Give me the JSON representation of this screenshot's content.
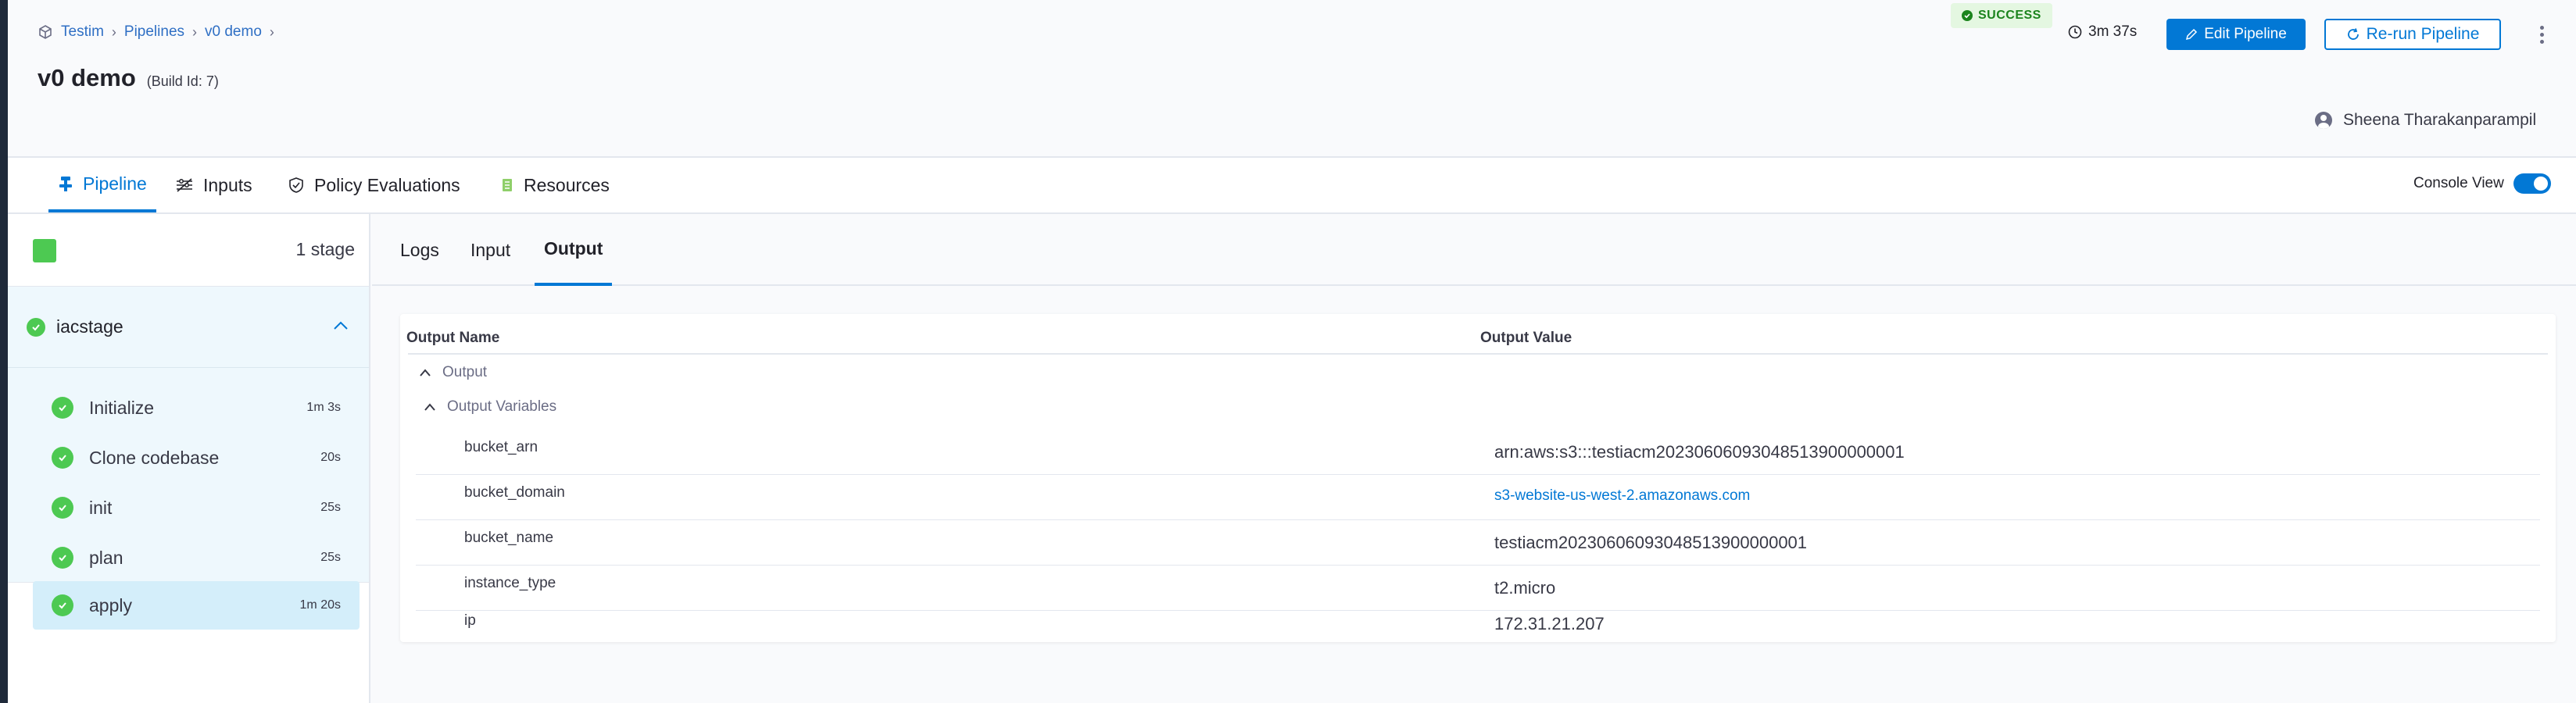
{
  "breadcrumb": {
    "project": "Testim",
    "section": "Pipelines",
    "pipeline": "v0 demo"
  },
  "header": {
    "title": "v0 demo",
    "build": "(Build Id: 7)",
    "status": "SUCCESS",
    "duration": "3m 37s",
    "edit_label": "Edit Pipeline",
    "rerun_label": "Re-run Pipeline",
    "user": "Sheena Tharakanparampil"
  },
  "tabs": [
    {
      "label": "Pipeline",
      "icon": "pipeline-icon",
      "active": true
    },
    {
      "label": "Inputs",
      "icon": "inputs-icon"
    },
    {
      "label": "Policy Evaluations",
      "icon": "policy-icon"
    },
    {
      "label": "Resources",
      "icon": "resources-icon"
    }
  ],
  "console_view": {
    "label": "Console View",
    "enabled": true
  },
  "stages": {
    "count_label": "1 stage",
    "stage_name": "iacstage",
    "steps": [
      {
        "label": "Initialize",
        "time": "1m 3s"
      },
      {
        "label": "Clone codebase",
        "time": "20s"
      },
      {
        "label": "init",
        "time": "25s"
      },
      {
        "label": "plan",
        "time": "25s"
      },
      {
        "label": "apply",
        "time": "1m 20s",
        "active": true
      }
    ]
  },
  "detail_tabs": [
    "Logs",
    "Input",
    "Output"
  ],
  "output": {
    "col_name": "Output Name",
    "col_value": "Output Value",
    "group": "Output",
    "subgroup": "Output Variables",
    "rows": [
      {
        "name": "bucket_arn",
        "value": "arn:aws:s3:::testiacm20230606093048513900000001"
      },
      {
        "name": "bucket_domain",
        "value": "s3-website-us-west-2.amazonaws.com"
      },
      {
        "name": "bucket_name",
        "value": "testiacm20230606093048513900000001"
      },
      {
        "name": "instance_type",
        "value": "t2.micro"
      },
      {
        "name": "ip",
        "value": "172.31.21.207"
      }
    ]
  },
  "colors": {
    "accent": "#0278d5",
    "success": "#4dc952",
    "sidebar": "#1f2a3a"
  }
}
